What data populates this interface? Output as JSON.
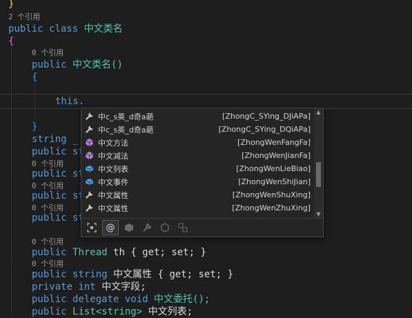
{
  "editor": {
    "top_brace": "}",
    "ref_2": "2 个引用",
    "class_kw1": "public",
    "class_kw2": "class",
    "class_name": "中文类名",
    "open_brace": "{",
    "ref_0a": "0 个引用",
    "ctor_kw": "public",
    "ctor_name": "中文类名()",
    "ctor_open": "{",
    "this_text": "this.",
    "ctor_close": "}",
    "line_string": "string _",
    "line_public1": "public st",
    "ref_0b": "0 个引用",
    "line_public2": "public st",
    "ref_0c": "0 个引用",
    "line_public3": "public st",
    "ref_0d": "0 个引用",
    "line_public4": "public st",
    "ref_0e": "0 个引用",
    "thread_line": {
      "kw": "public",
      "type": "Thread",
      "rest": "th { get; set; }"
    },
    "ref_0f": "0 个引用",
    "prop_line": {
      "kw": "public",
      "type": "string",
      "name": "中文属性",
      "rest": "{ get; set; }"
    },
    "field_line": {
      "kw1": "private",
      "kw2": "int",
      "name": "中文字段;"
    },
    "delegate_line": {
      "kw1": "public",
      "kw2": "delegate",
      "kw3": "void",
      "name": "中文委托();"
    },
    "list_line": {
      "kw": "public",
      "type": "List<string>",
      "name": "中文列表;"
    }
  },
  "completion": {
    "items": [
      {
        "icon": "wrench-icon",
        "label": "中c_s英_d奇a葩",
        "pinyin": "[ZhongC_SYing_DJiAPa]"
      },
      {
        "icon": "wrench-icon",
        "label": "中c_s英_d奇a葩",
        "pinyin": "[ZhongC_SYing_DQiAPa]"
      },
      {
        "icon": "method-icon",
        "label": "中文方法",
        "pinyin": "[ZhongWenFangFa]"
      },
      {
        "icon": "method-icon",
        "label": "中文减法",
        "pinyin": "[ZhongWenJianFa]"
      },
      {
        "icon": "field-icon",
        "label": "中文列表",
        "pinyin": "[ZhongWenLieBiao]"
      },
      {
        "icon": "event-icon",
        "label": "中文事件",
        "pinyin": "[ZhongWenShiJian]"
      },
      {
        "icon": "wrench-icon",
        "label": "中文属性",
        "pinyin": "[ZhongWenShuXing]"
      },
      {
        "icon": "wrench-icon",
        "label": "中文属性",
        "pinyin": "[ZhongWenZhuXing]"
      }
    ],
    "filters": [
      "focus-filter-icon",
      "at-sign-filter-icon",
      "class-filter-icon",
      "wrench-filter-icon",
      "cube-filter-icon",
      "namespace-filter-icon"
    ],
    "scroll_up": "▲",
    "scroll_down": "▼"
  }
}
